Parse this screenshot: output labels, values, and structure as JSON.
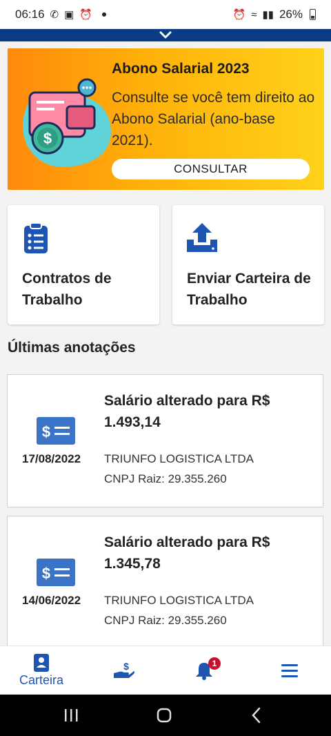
{
  "status_bar": {
    "time": "06:16",
    "battery": "26%"
  },
  "banner": {
    "title": "Abono Salarial 2023",
    "description": "Consulte se você tem direito ao Abono Salarial (ano-base 2021).",
    "button_label": "CONSULTAR"
  },
  "actions": [
    {
      "label": "Contratos de Trabalho",
      "icon": "clipboard-list-icon"
    },
    {
      "label": "Enviar Carteira de Trabalho",
      "icon": "upload-icon"
    }
  ],
  "section_title": "Últimas anotações",
  "entries": [
    {
      "title": "Salário alterado para R$ 1.493,14",
      "date": "17/08/2022",
      "company": "TRIUNFO LOGISTICA LTDA",
      "cnpj": "CNPJ Raiz: 29.355.260"
    },
    {
      "title": "Salário alterado para R$ 1.345,78",
      "date": "14/06/2022",
      "company": "TRIUNFO LOGISTICA LTDA",
      "cnpj": "CNPJ Raiz: 29.355.260"
    }
  ],
  "tabbar": {
    "tabs": [
      {
        "label": "Carteira",
        "icon": "person-card-icon",
        "active": true
      },
      {
        "label": "",
        "icon": "money-hand-icon"
      },
      {
        "label": "",
        "icon": "bell-icon",
        "badge": "1"
      },
      {
        "label": "",
        "icon": "menu-icon"
      }
    ]
  },
  "colors": {
    "primary": "#1e55b3",
    "header": "#0b3b87",
    "badge": "#c8102e",
    "banner_start": "#ff8a0c",
    "banner_end": "#ffd21a"
  }
}
